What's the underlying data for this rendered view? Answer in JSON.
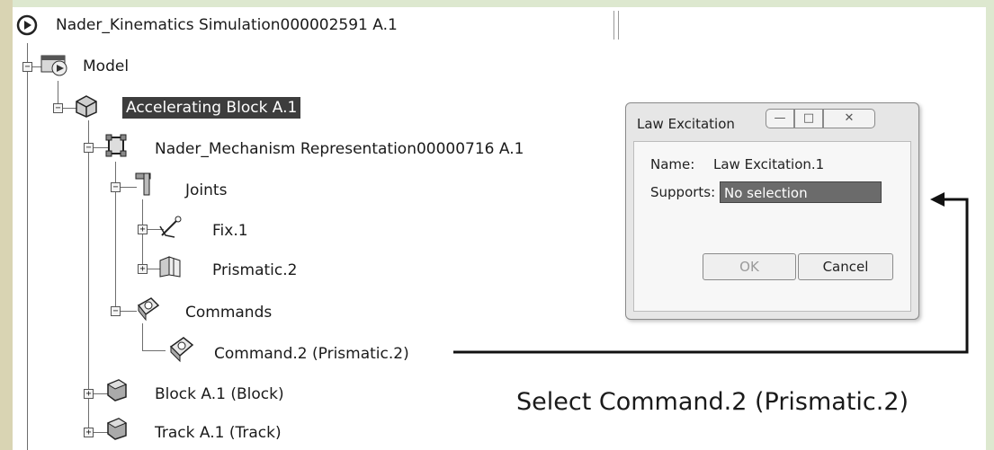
{
  "tree": {
    "root": "Nader_Kinematics Simulation000002591 A.1",
    "model": "Model",
    "accelerating_block": "Accelerating Block A.1",
    "mechanism": "Nader_Mechanism Representation00000716 A.1",
    "joints": "Joints",
    "fix": "Fix.1",
    "prismatic": "Prismatic.2",
    "commands": "Commands",
    "command2": "Command.2 (Prismatic.2)",
    "block": "Block A.1 (Block)",
    "track": "Track A.1 (Track)"
  },
  "dialog": {
    "title": "Law Excitation",
    "minimize": "—",
    "maximize": "□",
    "close": "✕",
    "name_label": "Name:",
    "name_value": "Law Excitation.1",
    "supports_label": "Supports:",
    "supports_value": "No selection",
    "ok_label": "OK",
    "cancel_label": "Cancel"
  },
  "annotation": {
    "text": "Select Command.2 (Prismatic.2)"
  },
  "icons": {
    "root": "play-icon",
    "model": "model-icon",
    "product": "product-icon",
    "mechanism": "mechanism-icon",
    "joints": "joints-icon",
    "fix": "fix-joint-icon",
    "prismatic": "prismatic-joint-icon",
    "commands": "commands-icon",
    "command": "command-icon",
    "block": "part-icon",
    "track": "part-icon"
  }
}
